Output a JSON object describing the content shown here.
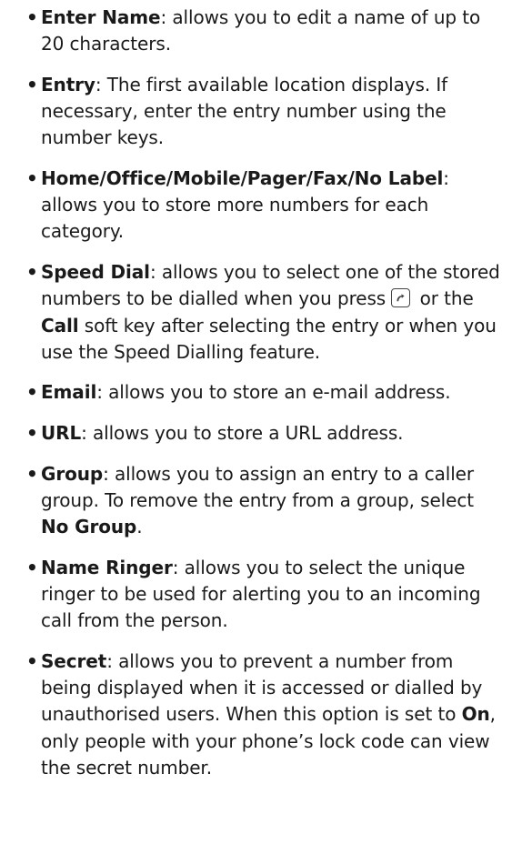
{
  "bullet": "•",
  "items": [
    {
      "term": "Enter Name",
      "text": ": allows you to edit a name of up to 20 characters."
    },
    {
      "term": "Entry",
      "text": ": The first available location displays. If necessary, enter the entry number using the number keys."
    },
    {
      "term": "Home/Office/Mobile/Pager/Fax/No Label",
      "text": ": allows you to store more numbers for each category."
    },
    {
      "term": "Speed Dial",
      "text_a": ": allows you to select one of the stored numbers to be dialled when you press",
      "icon": "call-key-icon",
      "text_b": " or the ",
      "term2": "Call",
      "text_c": " soft key after selecting the entry or when you use the Speed Dialling feature."
    },
    {
      "term": "Email",
      "text": ": allows you to store an e-mail address."
    },
    {
      "term": "URL",
      "text": ": allows you to store a URL address."
    },
    {
      "term": "Group",
      "text_a": ": allows you to assign an entry to a caller group. To remove the entry from a group, select ",
      "term2": "No Group",
      "text_b": "."
    },
    {
      "term": "Name Ringer",
      "text": ": allows you to select the unique ringer to be used for alerting you to an incoming call from the person."
    },
    {
      "term": "Secret",
      "text_a": ": allows you to prevent a number from being displayed when it is accessed or dialled by unauthorised users. When this option is set to ",
      "term2": "On",
      "text_b": ", only people with your phone’s lock code can view the secret number."
    }
  ]
}
